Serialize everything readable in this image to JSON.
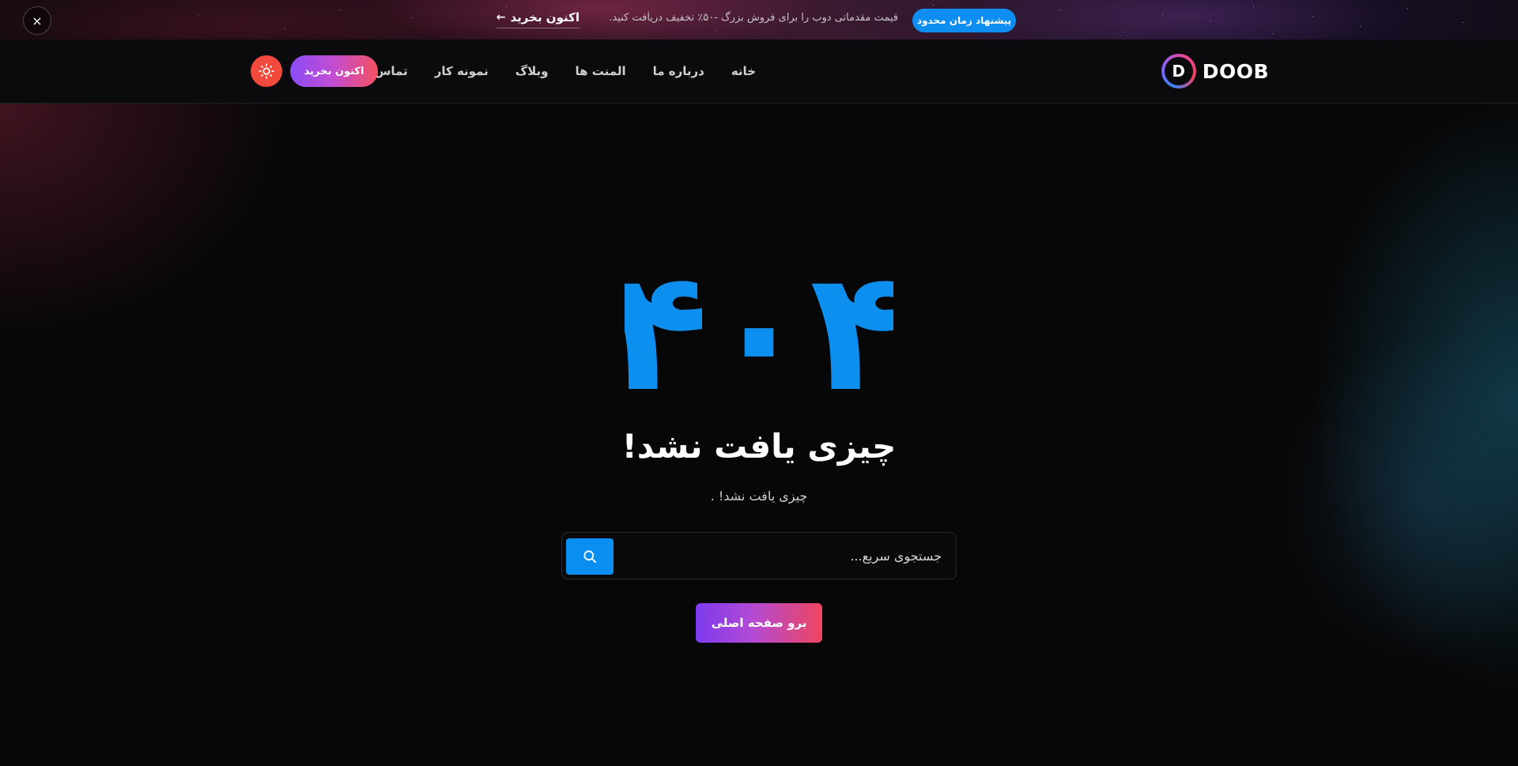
{
  "promo": {
    "badge": "پیشنهاد زمان محدود",
    "text": "قیمت مقدماتی دوب را برای فروش بزرگ -۵۰٪ تخفیف دریافت کنید.",
    "link_label": "اکنون بخرید",
    "close_icon": "×"
  },
  "header": {
    "logo_letter": "D",
    "logo_text": "DOOB",
    "nav": [
      {
        "label": "خانه"
      },
      {
        "label": "درباره ما"
      },
      {
        "label": "المنت ها"
      },
      {
        "label": "وبلاگ"
      },
      {
        "label": "نمونه کار"
      },
      {
        "label": "تماس"
      }
    ],
    "buy_label": "اکنون بخرید",
    "theme_toggle_icon": "sun-icon"
  },
  "main": {
    "error_code": "۴۰۴",
    "title": "چیزی یافت نشد!",
    "subtitle": "چیزی یافت نشد! .",
    "search": {
      "placeholder": "جستجوی سریع...",
      "value": "",
      "button_icon": "search-icon"
    },
    "home_button_label": "برو صفحه اصلی"
  },
  "colors": {
    "accent_blue": "#0a8ef2",
    "error_code": "#0d8ff0",
    "gradient_start": "#7c3aed",
    "gradient_end": "#f0455f",
    "theme_toggle": "#f14a3c",
    "background": "#070708"
  }
}
